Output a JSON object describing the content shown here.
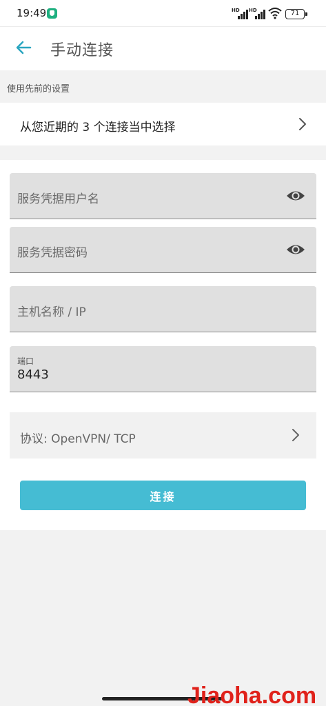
{
  "status_bar": {
    "time": "19:49",
    "battery": "71",
    "signal_labels": [
      "HD",
      "HD"
    ]
  },
  "app_bar": {
    "title": "手动连接",
    "back_icon": "arrow-left-icon",
    "accent_color": "#2aa6c0"
  },
  "recent": {
    "section_label": "使用先前的设置",
    "row_text": "从您近期的 3 个连接当中选择"
  },
  "form": {
    "username": {
      "placeholder": "服务凭据用户名",
      "icon": "eye-icon"
    },
    "password": {
      "placeholder": "服务凭据密码",
      "icon": "eye-icon"
    },
    "hostname": {
      "placeholder": "主机名称 / IP"
    },
    "port": {
      "label": "端口",
      "value": "8443"
    },
    "protocol": {
      "text": "协议: OpenVPN/ TCP"
    },
    "connect_button": "连接"
  },
  "watermark": "Jiaoha.com",
  "colors": {
    "button": "#45bcd3",
    "field_bg": "#e0e0e0",
    "page_bg": "#f2f2f2",
    "watermark": "#e0221b"
  }
}
